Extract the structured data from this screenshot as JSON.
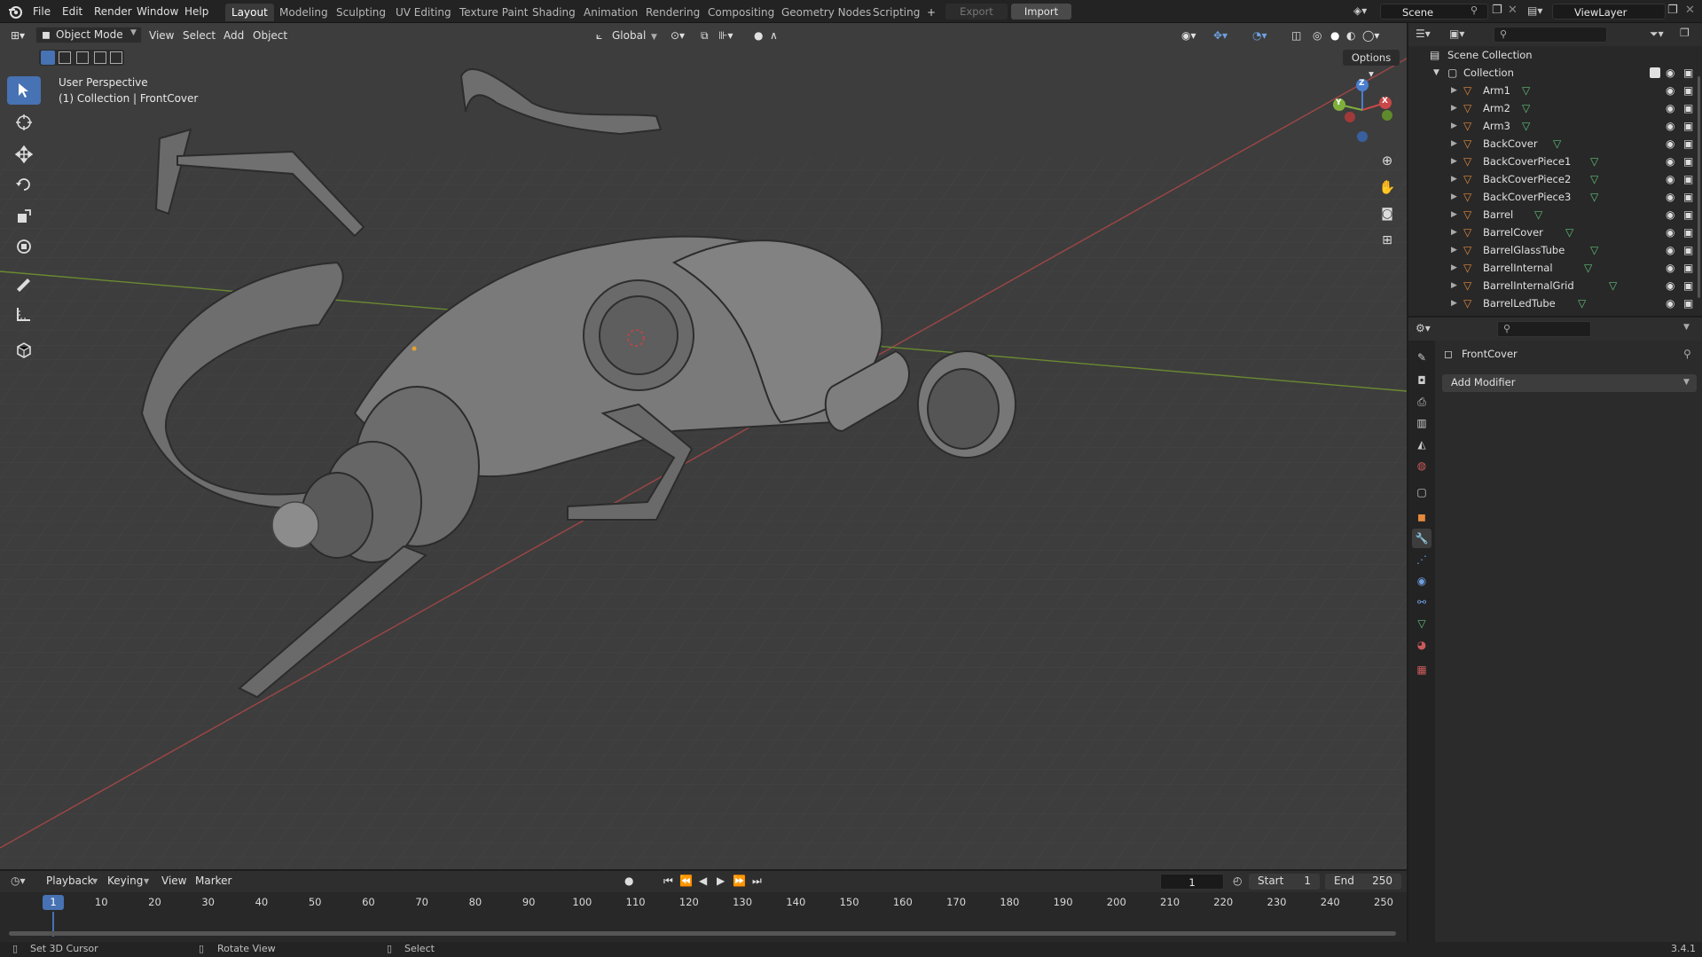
{
  "menu": {
    "file": "File",
    "edit": "Edit",
    "render": "Render",
    "window": "Window",
    "help": "Help"
  },
  "workspaces": [
    "Layout",
    "Modeling",
    "Sculpting",
    "UV Editing",
    "Texture Paint",
    "Shading",
    "Animation",
    "Rendering",
    "Compositing",
    "Geometry Nodes",
    "Scripting"
  ],
  "active_workspace": "Layout",
  "top_buttons": {
    "export": "Export",
    "import": "Import",
    "add_workspace": "+"
  },
  "scene": {
    "name": "Scene",
    "view_layer": "ViewLayer"
  },
  "viewport_header": {
    "mode": "Object Mode",
    "view": "View",
    "select": "Select",
    "add": "Add",
    "object": "Object",
    "transform_orientation": "Global",
    "options": "Options"
  },
  "viewport_overlay": {
    "perspective": "User Perspective",
    "collection_info": "(1) Collection | FrontCover"
  },
  "gizmo": {
    "x": "X",
    "y": "Y",
    "z": "Z"
  },
  "outliner": {
    "scene_collection": "Scene Collection",
    "collection": "Collection",
    "items": [
      "Arm1",
      "Arm2",
      "Arm3",
      "BackCover",
      "BackCoverPiece1",
      "BackCoverPiece2",
      "BackCoverPiece3",
      "Barrel",
      "BarrelCover",
      "BarrelGlassTube",
      "BarrelInternal",
      "BarrelInternalGrid",
      "BarrelLedTube"
    ]
  },
  "properties": {
    "object_name": "FrontCover",
    "add_modifier": "Add Modifier"
  },
  "timeline": {
    "playback": "Playback",
    "keying": "Keying",
    "view": "View",
    "marker": "Marker",
    "current_frame": "1",
    "start_label": "Start",
    "start": "1",
    "end_label": "End",
    "end": "250",
    "ticks": [
      "1",
      "10",
      "20",
      "30",
      "40",
      "50",
      "60",
      "70",
      "80",
      "90",
      "100",
      "110",
      "120",
      "130",
      "140",
      "150",
      "160",
      "170",
      "180",
      "190",
      "200",
      "210",
      "220",
      "230",
      "240",
      "250"
    ]
  },
  "statusbar": {
    "left": "Set 3D Cursor",
    "middle": "Rotate View",
    "right": "Select",
    "version": "3.4.1"
  },
  "colors": {
    "accent": "#4772b3",
    "viewport_bg": "#3d3d3d",
    "x_axis": "#b34a4a",
    "y_axis": "#7a9a3a",
    "mesh_icon": "#e58a3a",
    "data_icon": "#5fc07a"
  }
}
